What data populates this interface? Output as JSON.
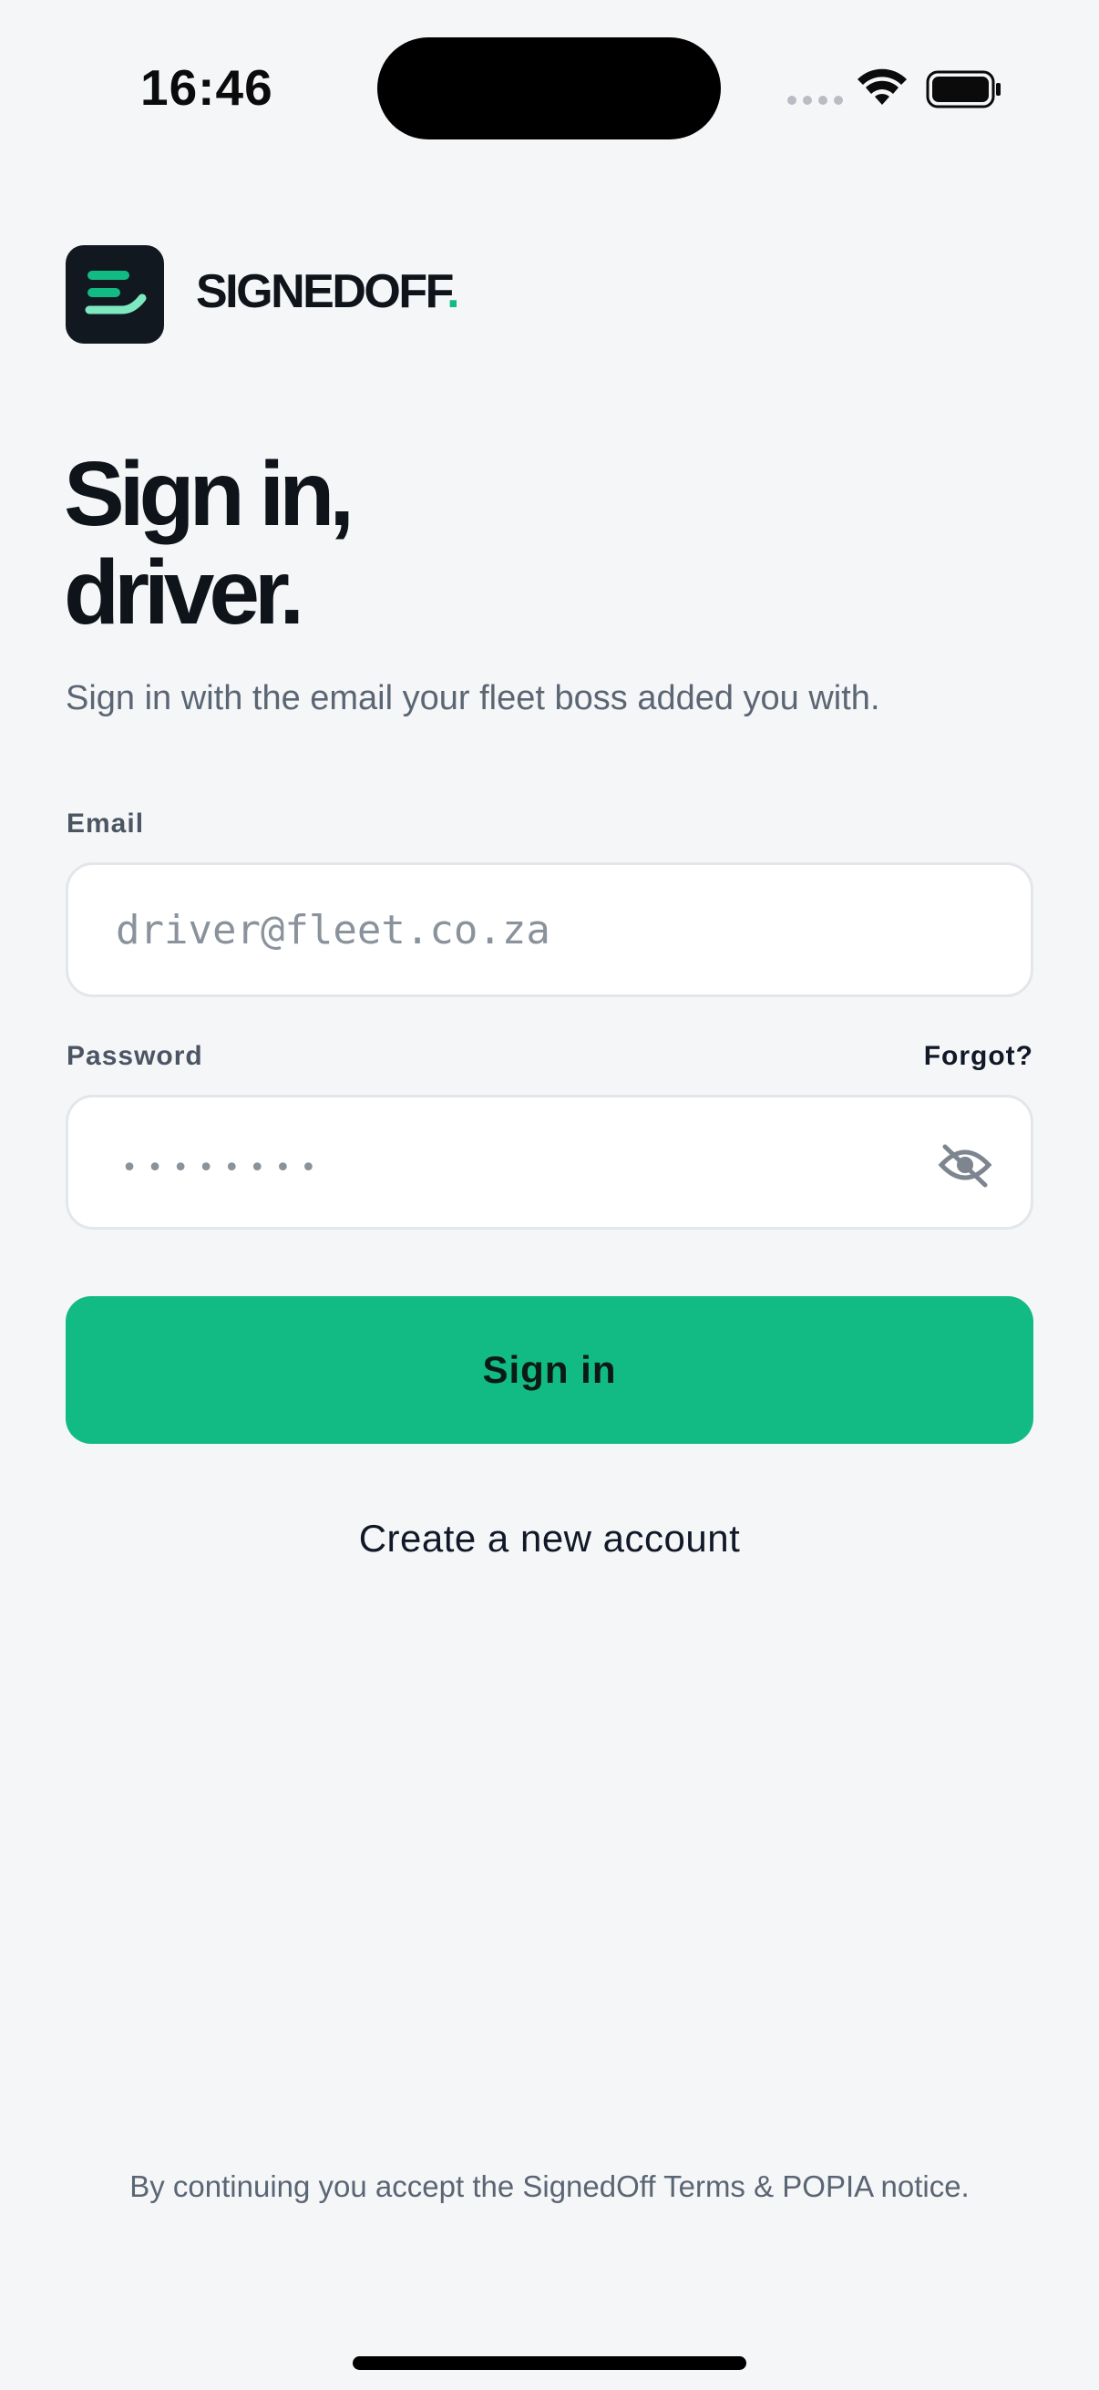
{
  "status_bar": {
    "time": "16:46",
    "wifi_icon": "wifi-icon",
    "battery_icon": "battery-icon"
  },
  "brand": {
    "name": "SIGNEDOFF",
    "dot": ".",
    "accent_color": "#12bb83",
    "logo_icon": "signature-logo-icon"
  },
  "headline": {
    "line1": "Sign in,",
    "line2": "driver."
  },
  "subtitle": "Sign in with the email your fleet boss added you with.",
  "form": {
    "email_label": "Email",
    "email_placeholder": "driver@fleet.co.za",
    "password_label": "Password",
    "forgot_label": "Forgot?",
    "password_mask": "••••••••",
    "toggle_visibility_icon": "eye-off-icon"
  },
  "actions": {
    "sign_in_label": "Sign in",
    "create_account_label": "Create a new account"
  },
  "footer": {
    "note": "By continuing you accept the SignedOff Terms & POPIA notice."
  }
}
